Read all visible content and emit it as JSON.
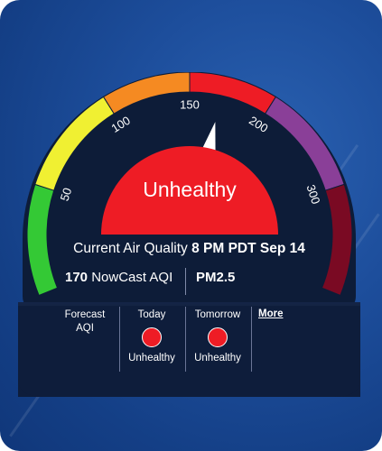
{
  "gauge": {
    "scale_labels": [
      "50",
      "100",
      "150",
      "200",
      "300"
    ],
    "category": "Unhealthy",
    "aqi_value": 170,
    "colors": {
      "good": "#34c935",
      "moderate": "#f0f032",
      "usg": "#f58a22",
      "unhealthy": "#ee1c25",
      "very_unhealthy": "#8a3f98",
      "hazardous": "#7a0a23",
      "panel": "#0d1c38"
    }
  },
  "current": {
    "title": "Current Air Quality",
    "time": "8 PM PDT Sep 14",
    "aqi_number": "170",
    "aqi_label": "NowCast AQI",
    "pollutant": "PM2.5"
  },
  "forecast": {
    "label_line1": "Forecast",
    "label_line2": "AQI",
    "today_label": "Today",
    "today_status": "Unhealthy",
    "tomorrow_label": "Tomorrow",
    "tomorrow_status": "Unhealthy",
    "more_link": "More"
  }
}
